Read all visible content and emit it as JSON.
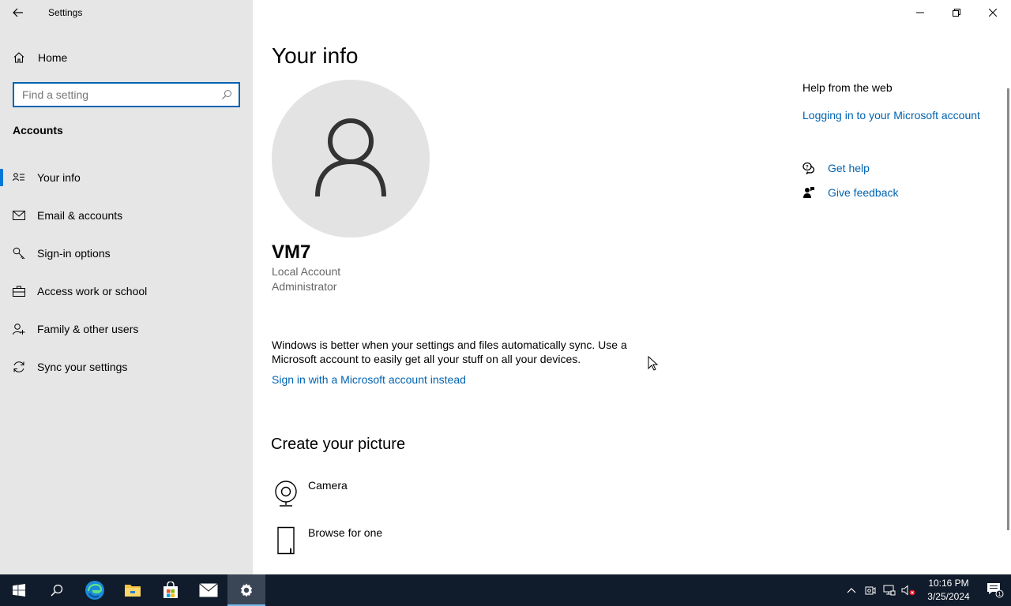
{
  "window": {
    "title": "Settings",
    "controls": [
      "minimize-icon",
      "restore-icon",
      "close-icon"
    ]
  },
  "sidebar": {
    "home_label": "Home",
    "search_placeholder": "Find a setting",
    "section_heading": "Accounts",
    "items": [
      {
        "label": "Your info",
        "icon": "contact-card-icon",
        "active": true
      },
      {
        "label": "Email & accounts",
        "icon": "mail-icon",
        "active": false
      },
      {
        "label": "Sign-in options",
        "icon": "key-icon",
        "active": false
      },
      {
        "label": "Access work or school",
        "icon": "briefcase-icon",
        "active": false
      },
      {
        "label": "Family & other users",
        "icon": "add-user-icon",
        "active": false
      },
      {
        "label": "Sync your settings",
        "icon": "sync-icon",
        "active": false
      }
    ]
  },
  "main": {
    "title": "Your info",
    "user": {
      "name": "VM7",
      "account_type": "Local Account",
      "role": "Administrator"
    },
    "sync_text": "Windows is better when your settings and files automatically sync. Use a Microsoft account to easily get all your stuff on all your devices.",
    "signin_link": "Sign in with a Microsoft account instead",
    "create_picture": {
      "heading": "Create your picture",
      "options": [
        {
          "label": "Camera",
          "icon": "camera-icon"
        },
        {
          "label": "Browse for one",
          "icon": "browse-file-icon"
        }
      ]
    }
  },
  "help": {
    "heading": "Help from the web",
    "web_link": "Logging in to your Microsoft account",
    "get_help": "Get help",
    "give_feedback": "Give feedback"
  },
  "taskbar": {
    "apps": [
      "windows-start-icon",
      "search-icon",
      "edge-icon",
      "file-explorer-icon",
      "store-icon",
      "mail-icon",
      "settings-icon"
    ],
    "time": "10:16 PM",
    "date": "3/25/2024",
    "notification_count": "1"
  },
  "colors": {
    "accent": "#0078d7",
    "link": "#0063b1",
    "sidebar_bg": "#e6e6e6",
    "taskbar_bg": "#101b2b"
  }
}
